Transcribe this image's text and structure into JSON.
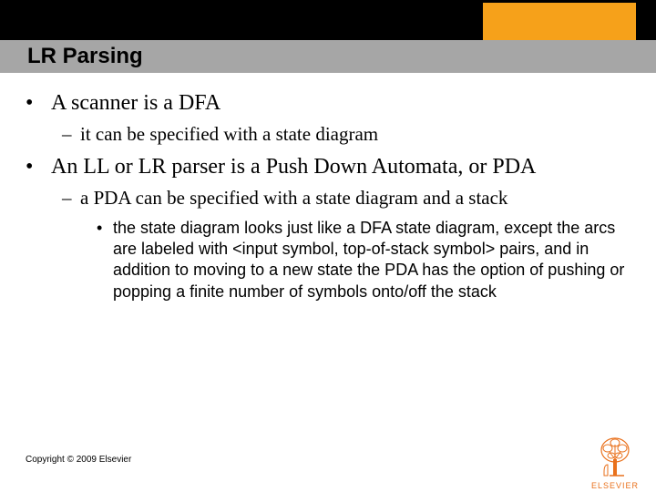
{
  "title": "LR Parsing",
  "bullets": {
    "b1": "A scanner is a DFA",
    "b1_sub": "it can be specified with a state diagram",
    "b2": "An LL or LR parser is a Push Down Automata, or PDA",
    "b2_sub": "a PDA can be specified with a state diagram and a stack",
    "b2_sub_sub": "the state diagram looks just like a DFA state diagram, except the arcs are labeled with <input symbol, top-of-stack symbol> pairs, and in addition to moving to a new state the PDA has the option of pushing or popping a finite number of symbols onto/off the stack"
  },
  "copyright": "Copyright © 2009 Elsevier",
  "logo_text": "ELSEVIER"
}
